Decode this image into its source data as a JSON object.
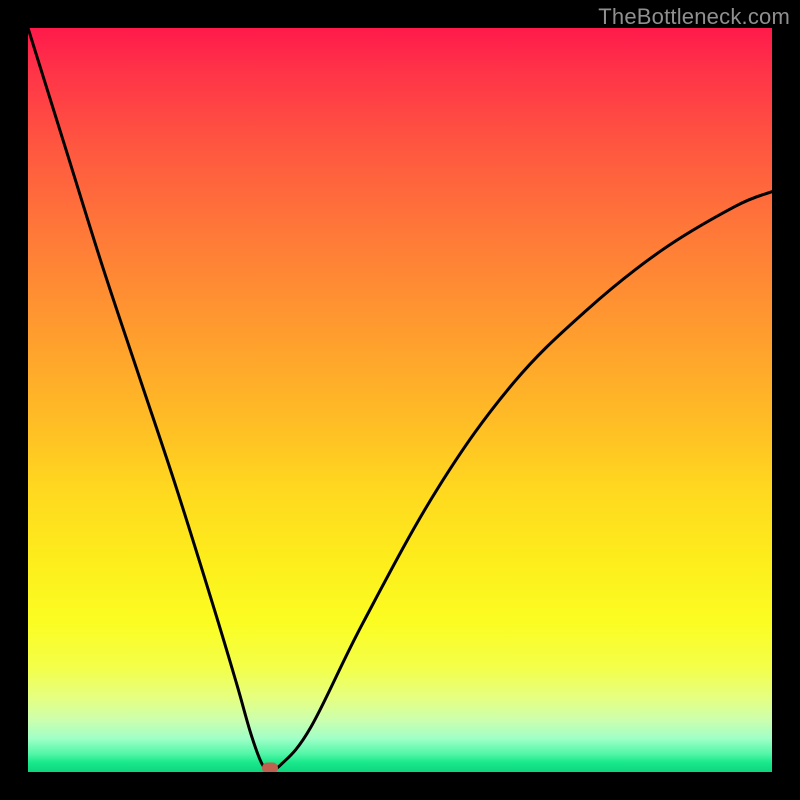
{
  "watermark": "TheBottleneck.com",
  "chart_data": {
    "type": "line",
    "title": "",
    "xlabel": "",
    "ylabel": "",
    "xlim": [
      0,
      100
    ],
    "ylim": [
      0,
      100
    ],
    "grid": false,
    "legend": false,
    "series": [
      {
        "name": "bottleneck-curve",
        "x": [
          0,
          5,
          10,
          15,
          20,
          25,
          28,
          30,
          31.5,
          32.5,
          34,
          38,
          45,
          55,
          65,
          75,
          85,
          95,
          100
        ],
        "y": [
          100,
          84,
          68,
          53,
          38,
          22,
          12,
          5,
          1,
          0.5,
          1,
          6,
          20,
          38,
          52,
          62,
          70,
          76,
          78
        ]
      }
    ],
    "marker": {
      "x": 32.5,
      "y": 0.5,
      "color": "#c0604f"
    },
    "background_gradient": {
      "top": "#ff1a4b",
      "mid": "#ffd81f",
      "bottom": "#0fd57d"
    }
  }
}
